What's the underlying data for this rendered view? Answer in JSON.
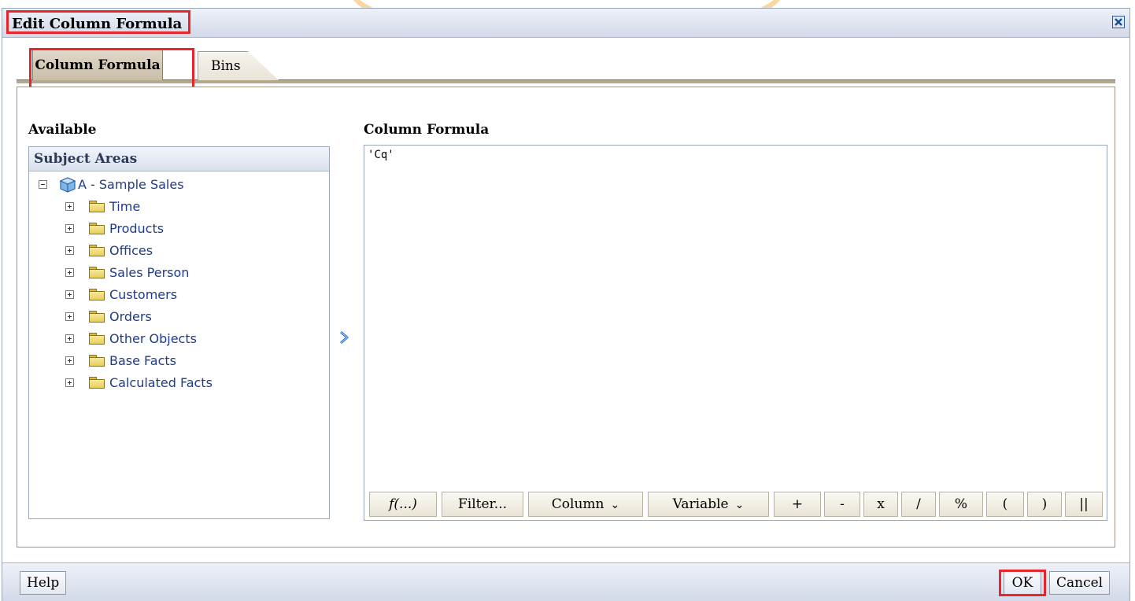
{
  "dialog": {
    "title": "Edit Column Formula"
  },
  "tabs": [
    {
      "label": "Column Formula",
      "active": true
    },
    {
      "label": "Bins",
      "active": false
    }
  ],
  "available": {
    "label": "Available",
    "panel_title": "Subject Areas",
    "root": {
      "label": "A - Sample Sales",
      "icon": "subject-area-cube-icon",
      "expanded": true
    },
    "folders": [
      {
        "label": "Time"
      },
      {
        "label": "Products"
      },
      {
        "label": "Offices"
      },
      {
        "label": "Sales Person"
      },
      {
        "label": "Customers"
      },
      {
        "label": "Orders"
      },
      {
        "label": "Other Objects"
      },
      {
        "label": "Base Facts"
      },
      {
        "label": "Calculated Facts"
      }
    ]
  },
  "formula": {
    "label": "Column Formula",
    "value": "'Cq'",
    "buttons": {
      "fx": "f(...)",
      "filter": "Filter...",
      "column": "Column",
      "variable": "Variable",
      "plus": "+",
      "minus": "-",
      "multiply": "x",
      "divide": "/",
      "percent": "%",
      "open_paren": "(",
      "close_paren": ")",
      "concat": "||"
    }
  },
  "footer": {
    "help": "Help",
    "ok": "OK",
    "cancel": "Cancel"
  },
  "colors": {
    "highlight": "#e8262a",
    "link_text": "#1f3b8c",
    "tab_active": "#c9bda7"
  }
}
